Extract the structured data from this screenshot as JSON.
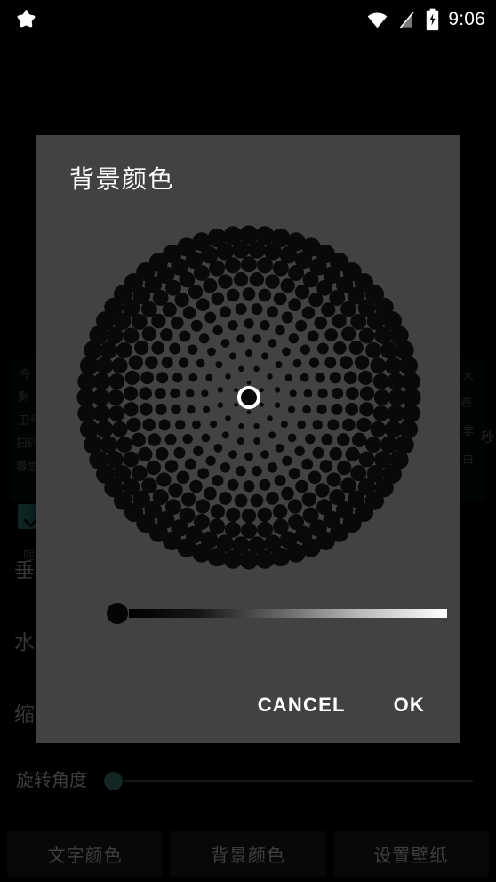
{
  "status_bar": {
    "notification_icon": "star-icon",
    "wifi_icon": "wifi-icon",
    "signal_icon": "no-sim-signal-icon",
    "battery_icon": "battery-charging-icon",
    "time": "9:06"
  },
  "background_app": {
    "obscured_rows": [
      {
        "label": "垂",
        "full": "垂"
      },
      {
        "label": "水",
        "full": "水"
      },
      {
        "label": "缩",
        "full": "缩"
      }
    ],
    "right_unit": "秒",
    "rotate_row": {
      "label": "旋转角度",
      "thumb_color": "#3e7f7b",
      "track_color": "#4a4f4e",
      "value_position_pct": 0
    },
    "bottom_buttons": [
      {
        "label": "文字颜色",
        "name": "text-color-button"
      },
      {
        "label": "背景颜色",
        "name": "background-color-button"
      },
      {
        "label": "设置壁纸",
        "name": "set-wallpaper-button"
      }
    ]
  },
  "dialog": {
    "title": "背景颜色",
    "background_color": "#424242",
    "color_wheel": {
      "name": "color-wheel",
      "selected_color": "#000000",
      "selector_position": "center",
      "rings": 11
    },
    "value_slider": {
      "name": "brightness-slider",
      "value_pct": 0,
      "gradient_from": "#000000",
      "gradient_to": "#ffffff",
      "thumb_color": "#000000"
    },
    "buttons": {
      "cancel": "CANCEL",
      "ok": "OK"
    }
  }
}
